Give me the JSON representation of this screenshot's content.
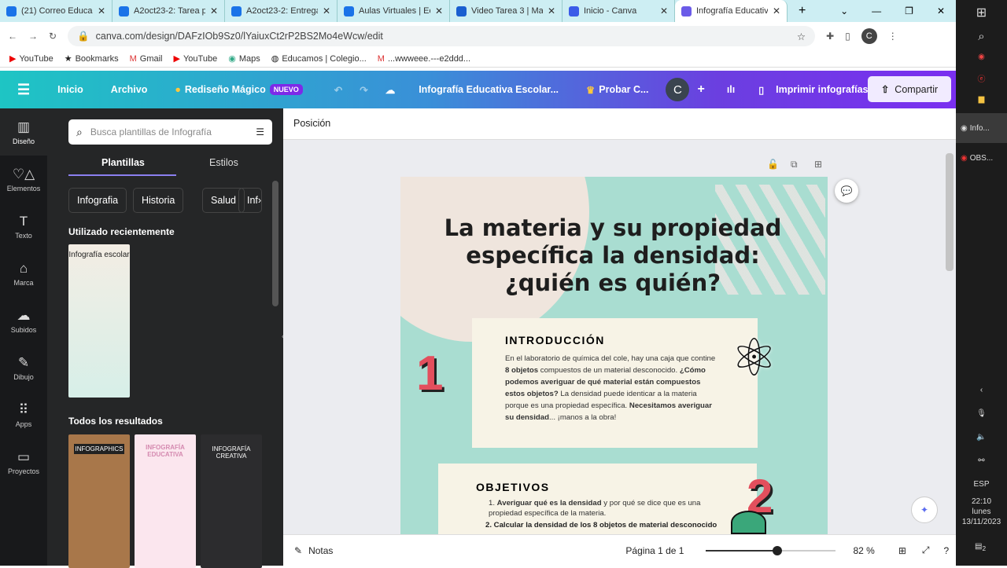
{
  "browser": {
    "tabs": [
      {
        "title": "(21) Correo Educa",
        "color": "#1a73e8"
      },
      {
        "title": "A2oct23-2: Tarea p",
        "color": "#1a73e8"
      },
      {
        "title": "A2oct23-2: Entrega",
        "color": "#1a73e8"
      },
      {
        "title": "Aulas Virtuales | Ed",
        "color": "#1a73e8"
      },
      {
        "title": "Video Tarea 3 | Ma",
        "color": "#1a5fd0"
      },
      {
        "title": "Inicio - Canva",
        "color": "#3b5be8"
      },
      {
        "title": "Infografía Educativa",
        "color": "#6b5be8"
      }
    ],
    "url": "canva.com/design/DAFzIOb9Sz0/lYaiuxCt2rP2BS2Mo4eWcw/edit",
    "bookmarks": [
      "YouTube",
      "Bookmarks",
      "Gmail",
      "YouTube",
      "Maps",
      "Educamos | Colegio...",
      "...wwweee.---e2ddd..."
    ],
    "profile": "C"
  },
  "header": {
    "inicio": "Inicio",
    "archivo": "Archivo",
    "magic": "Rediseño Mágico",
    "nuevo": "NUEVO",
    "doc_title": "Infografía Educativa Escolar...",
    "probar": "Probar C...",
    "avatar": "C",
    "print": "Imprimir infografías",
    "share": "Compartir"
  },
  "rail": [
    {
      "label": "Diseño",
      "icon": "▥"
    },
    {
      "label": "Elementos",
      "icon": "♡△"
    },
    {
      "label": "Texto",
      "icon": "T"
    },
    {
      "label": "Marca",
      "icon": "⌂"
    },
    {
      "label": "Subidos",
      "icon": "☁"
    },
    {
      "label": "Dibujo",
      "icon": "✎"
    },
    {
      "label": "Apps",
      "icon": "⠿"
    },
    {
      "label": "Proyectos",
      "icon": "▭"
    }
  ],
  "panel": {
    "search_placeholder": "Busca plantillas de Infografía",
    "tabs": [
      "Plantillas",
      "Estilos"
    ],
    "chips": [
      "Infografia",
      "Historia",
      "Salud",
      "Inf"
    ],
    "recent": "Utilizado recientemente",
    "recent_thumb": "Infografía escolar",
    "all": "Todos los resultados",
    "results": [
      "INFOGRAPHICS",
      "INFOGRAFÍA EDUCATIVA",
      "INFOGRAFÍA CREATIVA"
    ]
  },
  "toolbar": {
    "position": "Posición"
  },
  "design": {
    "title": "La materia y su propiedad específica la densidad: ¿quién es quién?",
    "n1": "1",
    "intro_h": "INTRODUCCIÓN",
    "intro": [
      "En el laboratorio de química del cole, hay una caja que contine ",
      "8 objetos",
      " compuestos de un material desconocido. ",
      "¿Cómo podemos averiguar de qué material están compuestos estos objetos?",
      " La densidad puede identicar a la materia porque es una propiedad específica. ",
      "Necesitamos averiguar su densidad",
      "... ¡manos a la obra!"
    ],
    "obj_h": "OBJETIVOS",
    "n2": "2",
    "obj1_b": "Averiguar qué es la densidad",
    "obj1": " y por qué se dice que es una propiedad específica de la materia.",
    "obj2": "2. Calcular la densidad de los 8 objetos de material desconocido"
  },
  "bottom": {
    "notes": "Notas",
    "page": "Página 1 de 1",
    "zoom": "82 %",
    "zoom_fraction": 0.55
  },
  "taskbar": {
    "apps": [
      "Info...",
      "OBS..."
    ],
    "lang": "ESP",
    "time": "22:10",
    "day": "lunes",
    "date": "13/11/2023",
    "notifications": "2"
  }
}
